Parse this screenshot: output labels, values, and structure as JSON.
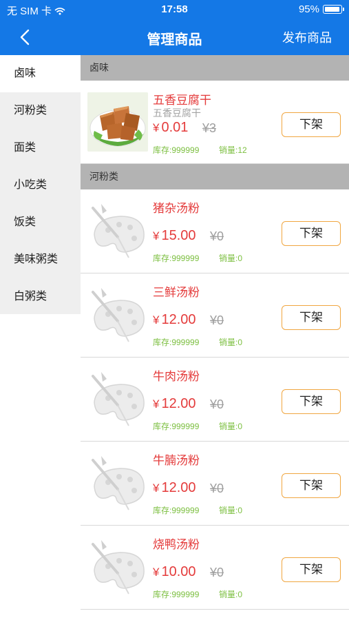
{
  "status_bar": {
    "carrier": "无 SIM 卡",
    "time": "17:58",
    "battery": "95%"
  },
  "nav": {
    "title": "管理商品",
    "publish": "发布商品"
  },
  "sidebar": {
    "items": [
      {
        "label": "卤味"
      },
      {
        "label": "河粉类"
      },
      {
        "label": "面类"
      },
      {
        "label": "小吃类"
      },
      {
        "label": "饭类"
      },
      {
        "label": "美味粥类"
      },
      {
        "label": "白粥类"
      }
    ]
  },
  "sections": [
    {
      "header": "卤味",
      "items": [
        {
          "name": "五香豆腐干",
          "subtitle": "五香豆腐干",
          "currency": "¥",
          "price": "0.01",
          "original_price": "¥3",
          "stock": "库存:999999",
          "sales": "销量:12",
          "action": "下架"
        }
      ]
    },
    {
      "header": "河粉类",
      "items": [
        {
          "name": "猪杂汤粉",
          "currency": "¥",
          "price": "15.00",
          "original_price": "¥0",
          "stock": "库存:999999",
          "sales": "销量:0",
          "action": "下架"
        },
        {
          "name": "三鲜汤粉",
          "currency": "¥",
          "price": "12.00",
          "original_price": "¥0",
          "stock": "库存:999999",
          "sales": "销量:0",
          "action": "下架"
        },
        {
          "name": "牛肉汤粉",
          "currency": "¥",
          "price": "12.00",
          "original_price": "¥0",
          "stock": "库存:999999",
          "sales": "销量:0",
          "action": "下架"
        },
        {
          "name": "牛腩汤粉",
          "currency": "¥",
          "price": "12.00",
          "original_price": "¥0",
          "stock": "库存:999999",
          "sales": "销量:0",
          "action": "下架"
        },
        {
          "name": "烧鸭汤粉",
          "currency": "¥",
          "price": "10.00",
          "original_price": "¥0",
          "stock": "库存:999999",
          "sales": "销量:0",
          "action": "下架"
        }
      ]
    }
  ],
  "colors": {
    "nav_bg": "#1478e6",
    "price": "#e43b3b",
    "meta": "#7cbf40",
    "button_border": "#f0a640"
  }
}
